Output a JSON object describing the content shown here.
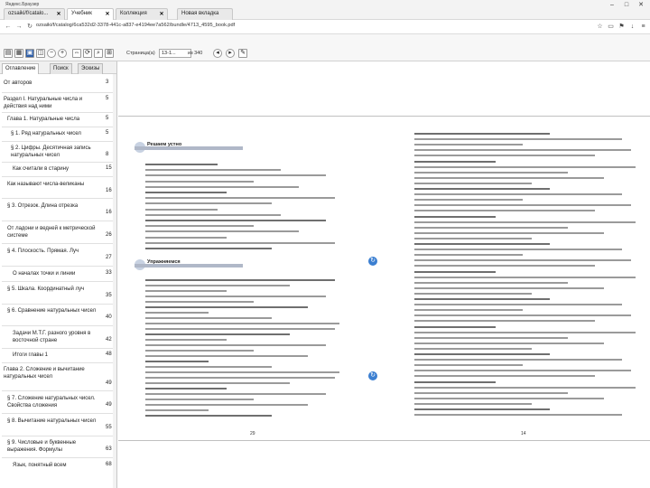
{
  "window": {
    "title": "Яндекс.Браузер",
    "tabs": [
      {
        "label": "ozsaiki/f/catalo...",
        "active": false
      },
      {
        "label": "Учебник",
        "active": true
      },
      {
        "label": "Коллекция",
        "active": false
      },
      {
        "label": "Новая вкладка",
        "active": false
      }
    ]
  },
  "address": {
    "url": "ozsaiki/f/catalog/6ca532d2-3378-441c-a837-e4194ee7a562/bundle/4713_4595_book.pdf"
  },
  "viewer": {
    "page_label": "Страница(а)",
    "page_value": "13-1...",
    "page_of": "из 340"
  },
  "sidebar": {
    "tabs": [
      "Оглавление",
      "Поиск",
      "Эскизы"
    ],
    "toc": [
      {
        "label": "От авторов",
        "page": "3"
      },
      {
        "label": "Раздел I. Натуральные числа и действия над ними",
        "page": "5"
      },
      {
        "label": "Глава 1. Натуральные числа",
        "page": "5"
      },
      {
        "label": "§ 1. Ряд натуральных чисел",
        "page": "5"
      },
      {
        "label": "§ 2. Цифры. Десятичная запись натуральных чисел",
        "page": "8"
      },
      {
        "label": "Как считали в старину",
        "page": "15"
      },
      {
        "label": "Как называют числа-великаны",
        "page": "16"
      },
      {
        "label": "§ 3. Отрезок. Длина отрезка",
        "page": "16"
      },
      {
        "label": "От ладони и ведней к метрической системе",
        "page": "26"
      },
      {
        "label": "§ 4. Плоскость. Прямая. Луч",
        "page": "27"
      },
      {
        "label": "О началах точки и линии",
        "page": "33"
      },
      {
        "label": "§ 5. Шкала. Координатный луч",
        "page": "35"
      },
      {
        "label": "§ 6. Сравнение натуральных чисел",
        "page": "40"
      },
      {
        "label": "Задачи М.Т.Г. разного уровня в восточной стране",
        "page": "42"
      },
      {
        "label": "Итоги главы 1",
        "page": "48"
      },
      {
        "label": "Глава 2. Сложение и вычитание натуральных чисел",
        "page": "49"
      },
      {
        "label": "§ 7. Сложение натуральных чисел. Свойства сложения",
        "page": "49"
      },
      {
        "label": "§ 8. Вычитание натуральных чисел",
        "page": "55"
      },
      {
        "label": "§ 9. Числовые и буквенные выражения. Формулы",
        "page": "63"
      },
      {
        "label": "Язык, понятный всем",
        "page": "68"
      }
    ]
  },
  "document": {
    "left_page": {
      "sections": [
        "Решаем устно",
        "Упражняемся"
      ],
      "footer": "29"
    },
    "right_page": {
      "footer": "14"
    }
  },
  "colors": {
    "accent": "#3b7fd1",
    "section_band": "#b0b8c8"
  }
}
